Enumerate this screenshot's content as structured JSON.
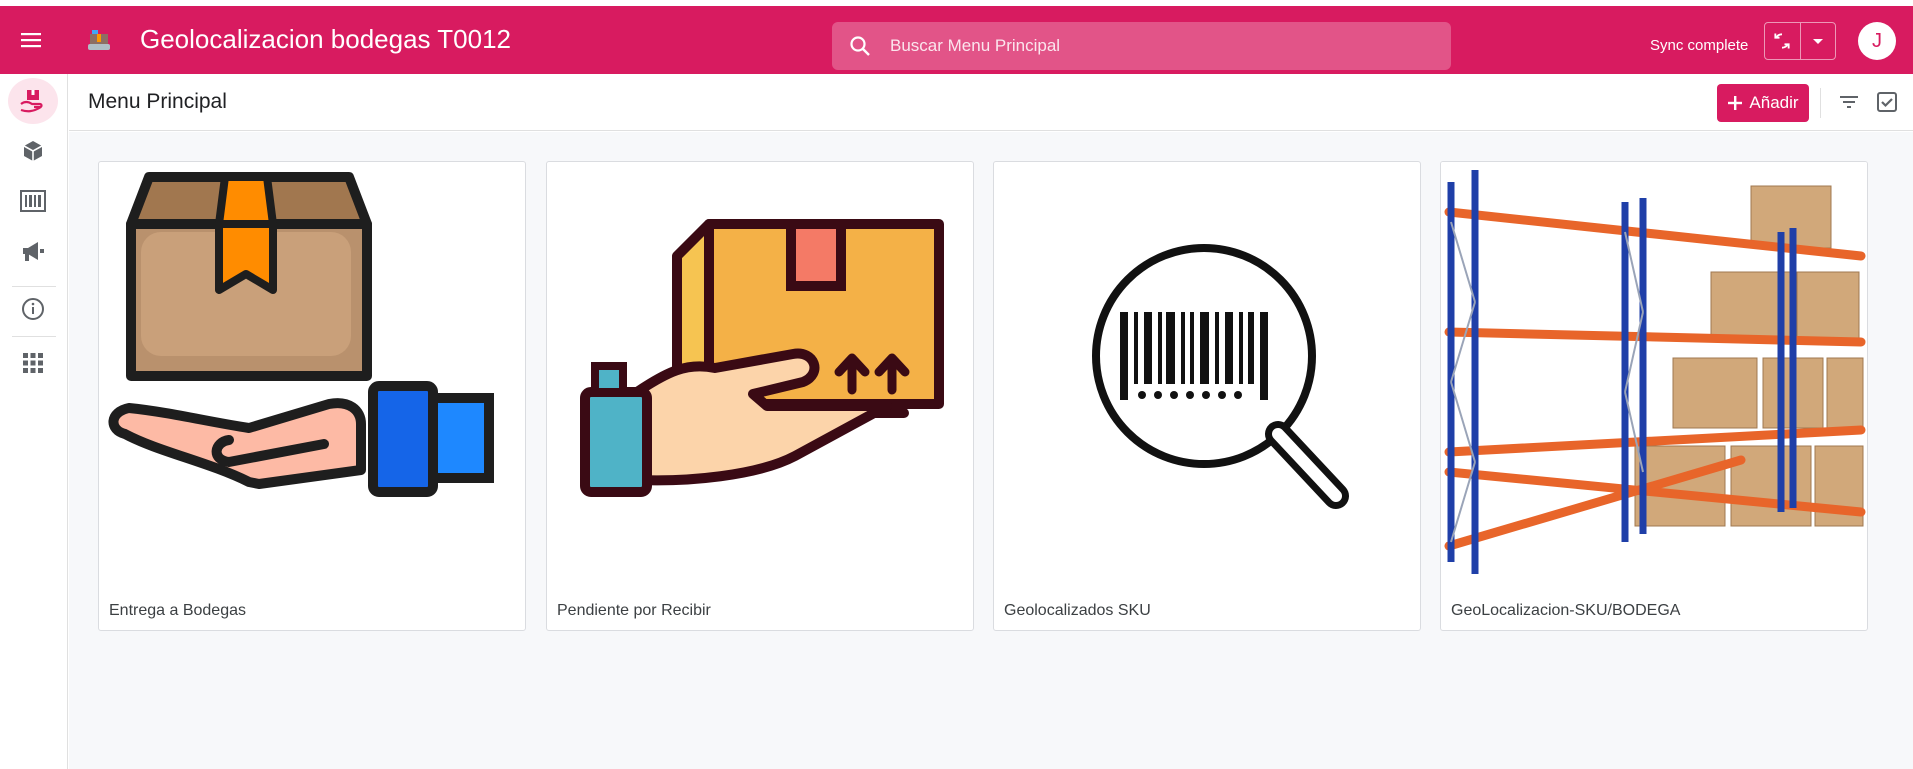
{
  "header": {
    "title": "Geolocalizacion bodegas T0012",
    "search_placeholder": "Buscar Menu Principal",
    "sync_status": "Sync complete",
    "avatar_initial": "J",
    "brand_color": "#d81b60"
  },
  "sidebar": {
    "items": [
      {
        "icon": "box-hand-icon",
        "active": true
      },
      {
        "icon": "cube-icon"
      },
      {
        "icon": "barcode-icon"
      },
      {
        "icon": "megaphone-icon"
      },
      {
        "icon": "info-icon"
      },
      {
        "icon": "apps-grid-icon"
      }
    ]
  },
  "toolbar": {
    "page_title": "Menu Principal",
    "add_label": "Añadir"
  },
  "cards": [
    {
      "label": "Entrega a Bodegas",
      "image": "box-on-hand-illustration"
    },
    {
      "label": "Pendiente por Recibir",
      "image": "hand-holding-package-illustration"
    },
    {
      "label": "Geolocalizados SKU",
      "image": "barcode-magnifier-illustration"
    },
    {
      "label": "GeoLocalizacion-SKU/BODEGA",
      "image": "warehouse-racks-photo"
    }
  ]
}
